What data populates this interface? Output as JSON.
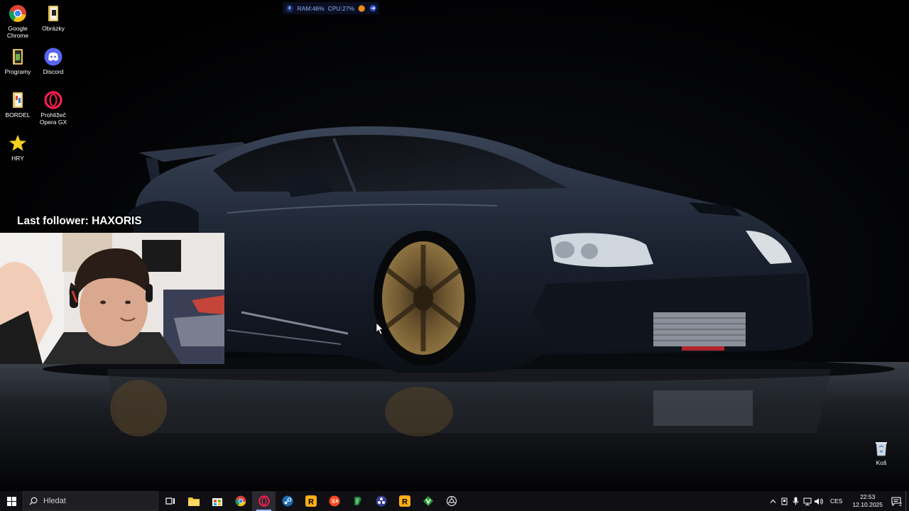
{
  "desktop_icons": [
    {
      "name": "google-chrome",
      "label": "Google Chrome",
      "icon": "chrome-icon"
    },
    {
      "name": "obrazky",
      "label": "Obrázky",
      "icon": "folder-icon"
    },
    {
      "name": "programy",
      "label": "Programy",
      "icon": "folder-icon"
    },
    {
      "name": "discord",
      "label": "Discord",
      "icon": "discord-icon"
    },
    {
      "name": "bordel",
      "label": "BORDEL",
      "icon": "folder-icon"
    },
    {
      "name": "opera-gx",
      "label": "Prohlížeč Opera GX",
      "icon": "opera-gx-icon"
    },
    {
      "name": "hry",
      "label": "HRY",
      "icon": "star-icon"
    }
  ],
  "perf_monitor": {
    "ram": "RAM:46%",
    "cpu": "CPU:27%"
  },
  "overlay": {
    "last_follower": "Last follower: HAXORIS"
  },
  "recycle_bin": {
    "label": "Koš"
  },
  "taskbar": {
    "search_placeholder": "Hledat",
    "apps": [
      "task-view-icon",
      "file-explorer-icon",
      "store-icon",
      "chrome-icon",
      "opera-gx-icon",
      "steam-icon",
      "rockstar-icon",
      "ea-icon",
      "bluestacks-icon",
      "obs-icon",
      "rockstar-icon",
      "vim-icon",
      "settings-icon"
    ],
    "tray": {
      "language": "CES",
      "time": "22:53",
      "date": "12.10.2025",
      "notification_count": "2"
    }
  },
  "colors": {
    "taskbar": "#101014",
    "accent": "#9ab8ff",
    "car": "#1b2230",
    "rim": "#6e5630"
  }
}
